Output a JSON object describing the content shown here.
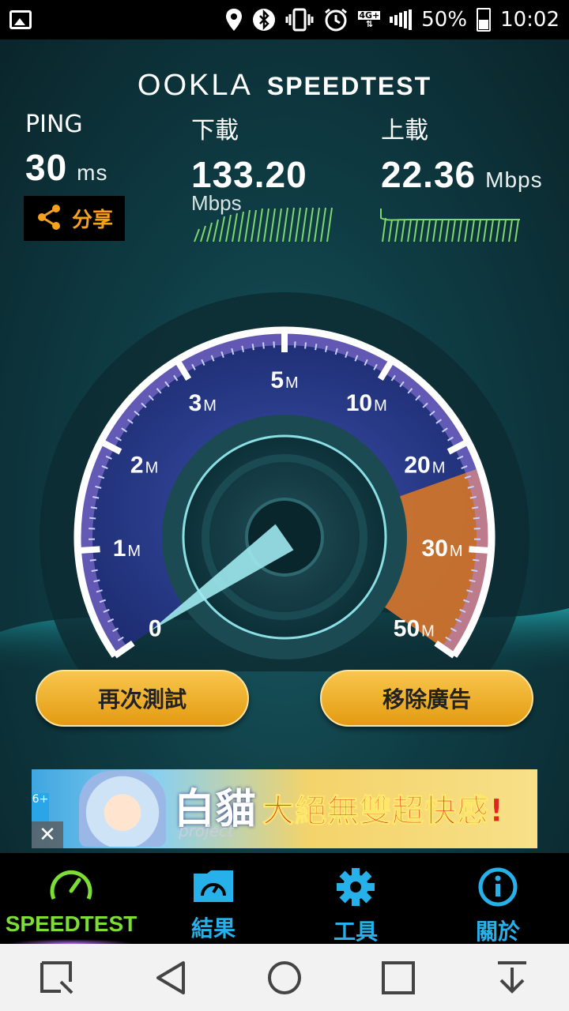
{
  "status_bar": {
    "network": "4G+",
    "battery_percent": "50%",
    "battery_level": 0.5,
    "time": "10:02",
    "icons": [
      "image-icon",
      "location-icon",
      "bluetooth-icon",
      "vibrate-icon",
      "alarm-icon",
      "data-arrows-icon",
      "signal-icon",
      "battery-icon"
    ]
  },
  "header": {
    "brand": "OOKLA",
    "product": "SPEEDTEST"
  },
  "results": {
    "ping": {
      "label": "PING",
      "value": "30",
      "unit": "ms"
    },
    "download": {
      "label": "下載",
      "value": "133.20",
      "unit": "Mbps"
    },
    "upload": {
      "label": "上載",
      "value": "22.36",
      "unit": "Mbps"
    }
  },
  "share": {
    "label": "分享",
    "icon": "share-icon"
  },
  "gauge": {
    "ticks": [
      {
        "num": "0",
        "suffix": ""
      },
      {
        "num": "1",
        "suffix": "M"
      },
      {
        "num": "2",
        "suffix": "M"
      },
      {
        "num": "3",
        "suffix": "M"
      },
      {
        "num": "5",
        "suffix": "M"
      },
      {
        "num": "10",
        "suffix": "M"
      },
      {
        "num": "20",
        "suffix": "M"
      },
      {
        "num": "30",
        "suffix": "M"
      },
      {
        "num": "50",
        "suffix": "M"
      }
    ],
    "needle_value": "0",
    "colors": {
      "arc": "#ffffff",
      "glow": "#b48cff",
      "highlight": "#f08a2a",
      "needle": "#8fe8ee",
      "face": "#2a3f8f"
    }
  },
  "buttons": {
    "retest": "再次測試",
    "remove_ads": "移除廣告"
  },
  "ad": {
    "headline": "大絕無雙超快感!",
    "logo": "白貓",
    "logo_sub": "project",
    "badge": "6+",
    "close": "✕"
  },
  "tabs": [
    {
      "label": "SPEEDTEST",
      "icon": "speedometer-icon",
      "color": "#7cde34",
      "active": true
    },
    {
      "label": "結果",
      "icon": "results-folder-icon",
      "color": "#27b1ea",
      "active": false
    },
    {
      "label": "工具",
      "icon": "gear-icon",
      "color": "#27b1ea",
      "active": false
    },
    {
      "label": "關於",
      "icon": "info-icon",
      "color": "#27b1ea",
      "active": false
    }
  ],
  "nav": [
    "screenshot-icon",
    "back-icon",
    "home-icon",
    "recents-icon",
    "notification-pull-icon"
  ]
}
